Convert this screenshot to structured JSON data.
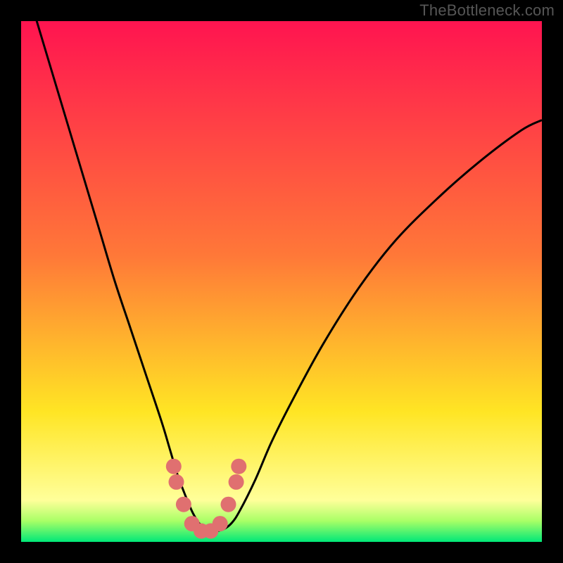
{
  "watermark": "TheBottleneck.com",
  "colors": {
    "top": "#FF1450",
    "mid1": "#FF7838",
    "mid2": "#FFE524",
    "band_yellow": "#FFFF9A",
    "band_lime": "#A8FF66",
    "bottom_green": "#00E878",
    "curve": "#000000",
    "marker": "#E07070"
  },
  "chart_data": {
    "type": "line",
    "title": "",
    "xlabel": "",
    "ylabel": "",
    "xlim": [
      0,
      100
    ],
    "ylim": [
      0,
      100
    ],
    "series": [
      {
        "name": "bottleneck-curve",
        "x": [
          0,
          3,
          6,
          9,
          12,
          15,
          18,
          21,
          24,
          27,
          28.5,
          30,
          31.5,
          33,
          34.5,
          36,
          37.5,
          39,
          40.5,
          42,
          45,
          48,
          52,
          58,
          65,
          72,
          80,
          88,
          96,
          100
        ],
        "y": [
          110,
          100,
          90,
          80,
          70,
          60,
          50,
          41,
          32,
          23,
          18,
          13,
          9,
          5.5,
          3.2,
          2.2,
          2.1,
          2.5,
          3.7,
          6,
          12,
          19,
          27,
          38,
          49,
          58,
          66,
          73,
          79,
          81
        ]
      }
    ],
    "markers": {
      "name": "highlight-points",
      "x": [
        29.3,
        29.8,
        31.2,
        32.8,
        34.6,
        36.4,
        38.2,
        39.8,
        41.3,
        41.8
      ],
      "y": [
        14.5,
        11.5,
        7.2,
        3.5,
        2.1,
        2.1,
        3.5,
        7.2,
        11.5,
        14.5
      ]
    },
    "gradient_bands": [
      {
        "y": 100,
        "color": "#FF1450"
      },
      {
        "y": 55,
        "color": "#FF7838"
      },
      {
        "y": 25,
        "color": "#FFE524"
      },
      {
        "y": 8,
        "color": "#FFFF9A"
      },
      {
        "y": 4,
        "color": "#A8FF66"
      },
      {
        "y": 0,
        "color": "#00E878"
      }
    ]
  }
}
